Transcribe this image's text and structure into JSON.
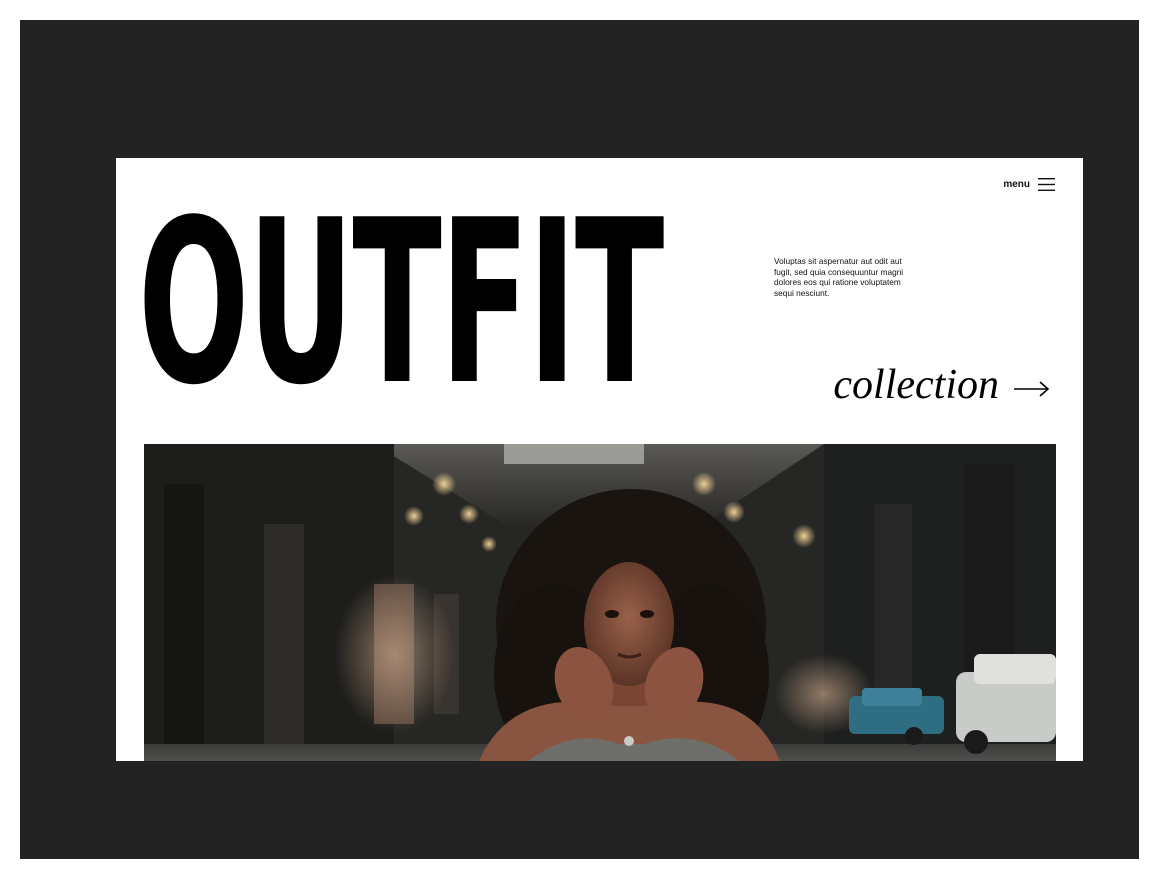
{
  "nav": {
    "menu_label": "menu",
    "menu_icon": "hamburger-icon"
  },
  "hero": {
    "title": "OUTFIT",
    "intro": "Voluptas sit aspernatur aut odit aut fugit, sed quia consequuntur magni dolores eos qui ratione voluptatem sequi nesciunt.",
    "collection_label": "collection",
    "collection_icon": "arrow-right-icon"
  },
  "colors": {
    "backdrop": "#232323",
    "page": "#ffffff",
    "text": "#000000"
  }
}
